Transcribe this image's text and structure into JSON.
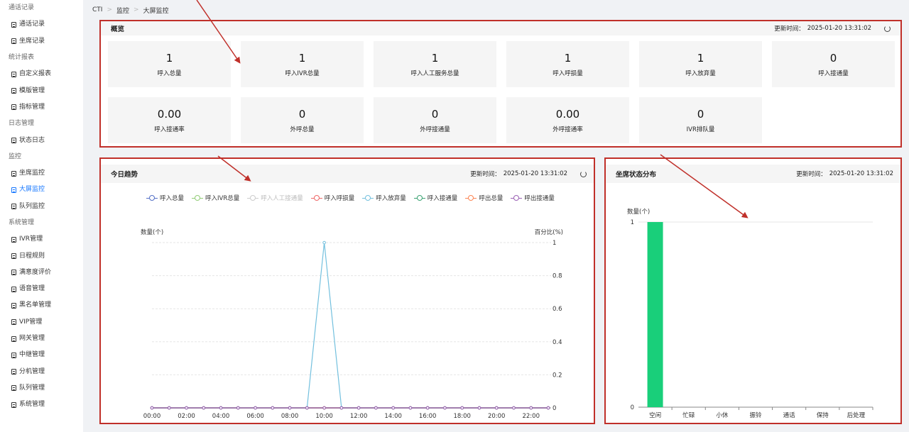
{
  "sidebar": {
    "groups": [
      {
        "label": "通话记录",
        "items": [
          "通话记录",
          "坐席记录"
        ]
      },
      {
        "label": "统计报表",
        "items": [
          "自定义报表",
          "模版管理",
          "指标管理"
        ]
      },
      {
        "label": "日志管理",
        "items": [
          "状态日志"
        ]
      },
      {
        "label": "监控",
        "items": [
          "坐席监控",
          "大屏监控",
          "队列监控"
        ]
      },
      {
        "label": "系统管理",
        "items": [
          "IVR管理",
          "日程规则",
          "满意度评价",
          "语音管理",
          "黑名单管理",
          "VIP管理",
          "网关管理",
          "中继管理",
          "分机管理",
          "队列管理",
          "系统管理"
        ]
      }
    ],
    "active_item": "大屏监控"
  },
  "breadcrumb": [
    "CTI",
    "监控",
    "大屏监控"
  ],
  "overview": {
    "title": "概览",
    "update_label": "更新时间：",
    "update_time": "2025-01-20 13:31:02",
    "cards": [
      {
        "value": "1",
        "label": "呼入总量"
      },
      {
        "value": "1",
        "label": "呼入IVR总量"
      },
      {
        "value": "1",
        "label": "呼入人工服务总量"
      },
      {
        "value": "1",
        "label": "呼入呼损量"
      },
      {
        "value": "1",
        "label": "呼入放弃量"
      },
      {
        "value": "0",
        "label": "呼入接通量"
      },
      {
        "value": "0.00",
        "label": "呼入接通率"
      },
      {
        "value": "0",
        "label": "外呼总量"
      },
      {
        "value": "0",
        "label": "外呼接通量"
      },
      {
        "value": "0.00",
        "label": "外呼接通率"
      },
      {
        "value": "0",
        "label": "IVR排队量"
      }
    ]
  },
  "trend": {
    "title": "今日趋势",
    "update_label": "更新时间：",
    "update_time": "2025-01-20 13:31:02"
  },
  "agent_status": {
    "title": "坐席状态分布",
    "update_label": "更新时间：",
    "update_time": "2025-01-20 13:31:02"
  },
  "colors": {
    "accent": "#1677ff",
    "highlight_border": "#c0302a",
    "bar_green": "#19cf7a"
  },
  "chart_data": [
    {
      "type": "line",
      "ylabel": "数量(个)",
      "y2label": "百分比(%)",
      "ylim": [
        0,
        1
      ],
      "y_ticks": [
        0,
        0.2,
        0.4,
        0.6,
        0.8,
        1
      ],
      "x_tick_labels": [
        "00:00",
        "02:00",
        "04:00",
        "06:00",
        "08:00",
        "10:00",
        "12:00",
        "14:00",
        "16:00",
        "18:00",
        "20:00",
        "22:00"
      ],
      "x": [
        "00:00",
        "01:00",
        "02:00",
        "03:00",
        "04:00",
        "05:00",
        "06:00",
        "07:00",
        "08:00",
        "09:00",
        "10:00",
        "11:00",
        "12:00",
        "13:00",
        "14:00",
        "15:00",
        "16:00",
        "17:00",
        "18:00",
        "19:00",
        "20:00",
        "21:00",
        "22:00",
        "23:00"
      ],
      "series": [
        {
          "name": "呼入总量",
          "color": "#5470c6",
          "values": [
            0,
            0,
            0,
            0,
            0,
            0,
            0,
            0,
            0,
            0,
            0,
            0,
            0,
            0,
            0,
            0,
            0,
            0,
            0,
            0,
            0,
            0,
            0,
            0
          ]
        },
        {
          "name": "呼入IVR总量",
          "color": "#91cc75",
          "values": [
            0,
            0,
            0,
            0,
            0,
            0,
            0,
            0,
            0,
            0,
            0,
            0,
            0,
            0,
            0,
            0,
            0,
            0,
            0,
            0,
            0,
            0,
            0,
            0
          ]
        },
        {
          "name": "呼入人工接通量",
          "color": "#cccccc",
          "hidden": true,
          "values": [
            0,
            0,
            0,
            0,
            0,
            0,
            0,
            0,
            0,
            0,
            0,
            0,
            0,
            0,
            0,
            0,
            0,
            0,
            0,
            0,
            0,
            0,
            0,
            0
          ]
        },
        {
          "name": "呼入呼损量",
          "color": "#ee6666",
          "values": [
            0,
            0,
            0,
            0,
            0,
            0,
            0,
            0,
            0,
            0,
            0,
            0,
            0,
            0,
            0,
            0,
            0,
            0,
            0,
            0,
            0,
            0,
            0,
            0
          ]
        },
        {
          "name": "呼入放弃量",
          "color": "#73c0de",
          "values": [
            0,
            0,
            0,
            0,
            0,
            0,
            0,
            0,
            0,
            0,
            1,
            0,
            0,
            0,
            0,
            0,
            0,
            0,
            0,
            0,
            0,
            0,
            0,
            0
          ]
        },
        {
          "name": "呼入接通量",
          "color": "#3ba272",
          "values": [
            0,
            0,
            0,
            0,
            0,
            0,
            0,
            0,
            0,
            0,
            0,
            0,
            0,
            0,
            0,
            0,
            0,
            0,
            0,
            0,
            0,
            0,
            0,
            0
          ]
        },
        {
          "name": "呼出总量",
          "color": "#fc8452",
          "values": [
            0,
            0,
            0,
            0,
            0,
            0,
            0,
            0,
            0,
            0,
            0,
            0,
            0,
            0,
            0,
            0,
            0,
            0,
            0,
            0,
            0,
            0,
            0,
            0
          ]
        },
        {
          "name": "呼出接通量",
          "color": "#9a60b4",
          "values": [
            0,
            0,
            0,
            0,
            0,
            0,
            0,
            0,
            0,
            0,
            0,
            0,
            0,
            0,
            0,
            0,
            0,
            0,
            0,
            0,
            0,
            0,
            0,
            0
          ]
        }
      ]
    },
    {
      "type": "bar",
      "ylabel": "数量(个)",
      "ylim": [
        0,
        1
      ],
      "y_ticks": [
        0,
        1
      ],
      "categories": [
        "空闲",
        "忙碌",
        "小休",
        "振铃",
        "通话",
        "保持",
        "后处理"
      ],
      "values": [
        1,
        0,
        0,
        0,
        0,
        0,
        0
      ]
    }
  ]
}
